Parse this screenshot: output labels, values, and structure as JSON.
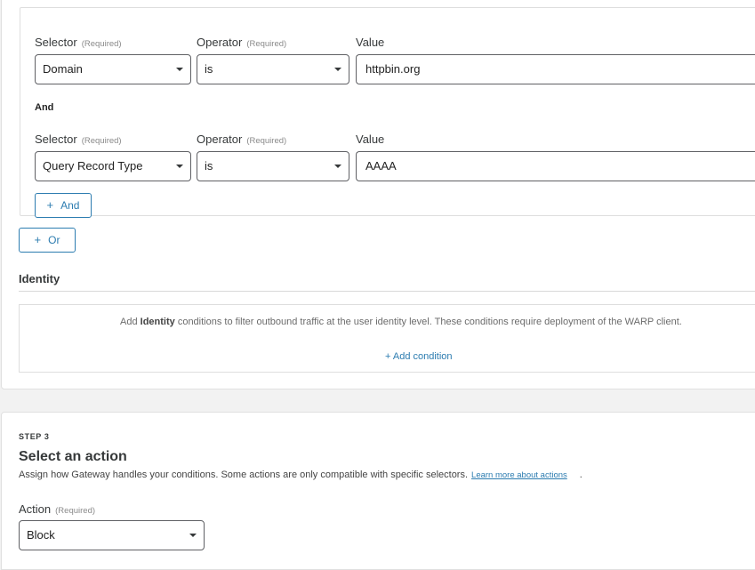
{
  "rules": [
    {
      "selector_label": "Selector",
      "selector_required": "(Required)",
      "operator_label": "Operator",
      "operator_required": "(Required)",
      "value_label": "Value",
      "selector_value": "Domain",
      "operator_value": "is",
      "value": "httpbin.org"
    },
    {
      "selector_label": "Selector",
      "selector_required": "(Required)",
      "operator_label": "Operator",
      "operator_required": "(Required)",
      "value_label": "Value",
      "selector_value": "Query Record Type",
      "operator_value": "is",
      "value": "AAAA"
    }
  ],
  "and_separator": "And",
  "and_button": "And",
  "or_button": "Or",
  "plus_glyph": "+",
  "identity": {
    "title": "Identity",
    "text_before": "Add ",
    "text_bold": "Identity",
    "text_after": " conditions to filter outbound traffic at the user identity level. These conditions require deployment of the WARP client.",
    "add_condition": "+ Add condition"
  },
  "step3": {
    "step_label": "STEP 3",
    "title": "Select an action",
    "description": "Assign how Gateway handles your conditions. Some actions are only compatible with specific selectors.",
    "learn_more": "Learn more about actions",
    "trailing": ".",
    "action_label": "Action",
    "action_required": "(Required)",
    "action_value": "Block"
  }
}
